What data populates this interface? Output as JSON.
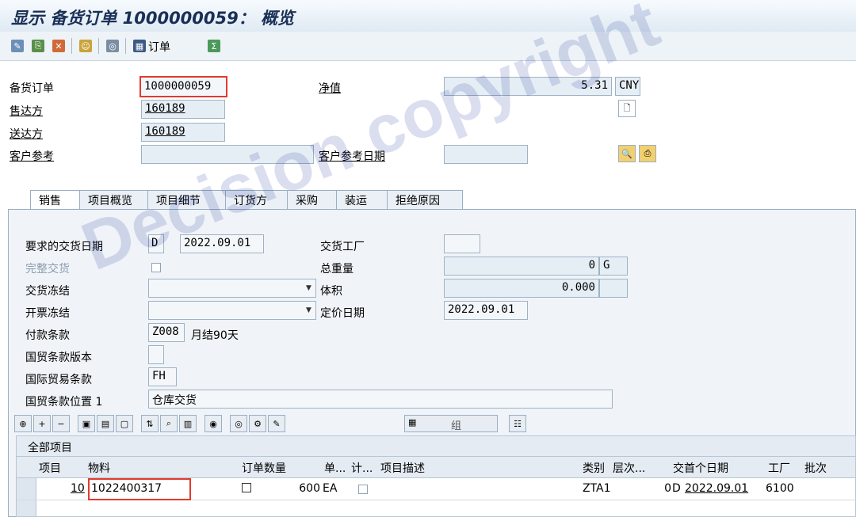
{
  "title": "显示 备货订单 1000000059： 概览",
  "toolbar": {
    "order_label": "订单"
  },
  "header": {
    "order_label": "备货订单",
    "order_value": "1000000059",
    "net_label": "净值",
    "net_value": "5.31",
    "currency": "CNY",
    "soldto_label": "售达方",
    "soldto_value": "160189",
    "shipto_label": "送达方",
    "shipto_value": "160189",
    "custref_label": "客户参考",
    "custref_value": "",
    "custref_date_label": "客户参考日期",
    "custref_date_value": ""
  },
  "tabs": [
    "销售",
    "项目概览",
    "项目细节",
    "订货方",
    "采购",
    "装运",
    "拒绝原因"
  ],
  "sales": {
    "req_date_label": "要求的交货日期",
    "req_date_type": "D",
    "req_date_value": "2022.09.01",
    "plant_label": "交货工厂",
    "plant_value": "",
    "complete_label": "完整交货",
    "weight_label": "总重量",
    "weight_value": "0",
    "weight_unit": "G",
    "delblock_label": "交货冻结",
    "volume_label": "体积",
    "volume_value": "0.000",
    "billblock_label": "开票冻结",
    "pricing_date_label": "定价日期",
    "pricing_date_value": "2022.09.01",
    "payterms_label": "付款条款",
    "payterms_code": "Z008",
    "payterms_text": "月结90天",
    "inco_version_label": "国贸条款版本",
    "inco_label": "国际贸易条款",
    "inco_value": "FH",
    "inco_loc_label": "国贸条款位置 1",
    "inco_loc_value": "仓库交货"
  },
  "grid": {
    "group_label": "组",
    "all_items_label": "全部项目",
    "columns": [
      "项目",
      "物料",
      "订单数量",
      "单...",
      "计...",
      "项目描述",
      "类别",
      "层次...",
      "交",
      "首个日期",
      "工厂",
      "批次"
    ],
    "rows": [
      {
        "item": "10",
        "material": "1022400317",
        "qty": "600",
        "unit": "EA",
        "desc": "",
        "category": "ZTA1",
        "level": "0",
        "delivery": "D",
        "date": "2022.09.01",
        "plant": "6100",
        "batch": ""
      }
    ]
  },
  "watermark": "Decision copyright",
  "colors": {
    "title": "#1a2f56",
    "highlight": "#e33a2e",
    "field_bg": "#e6eef5"
  }
}
